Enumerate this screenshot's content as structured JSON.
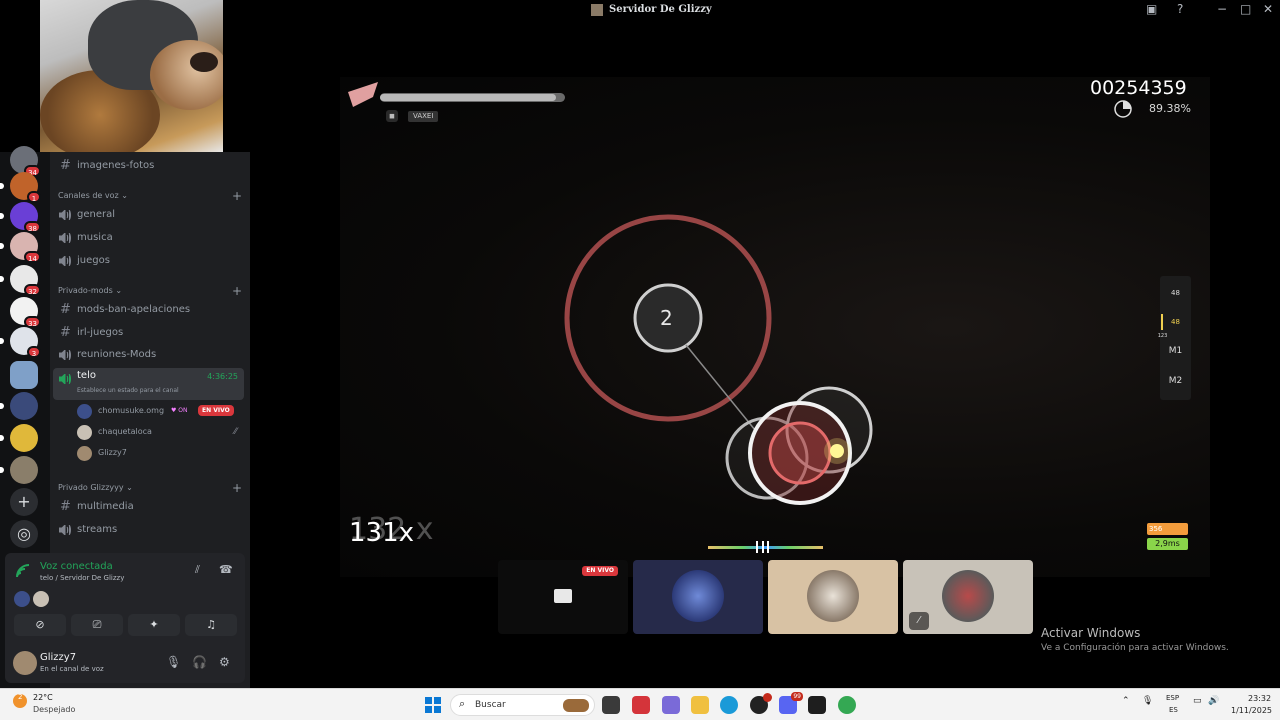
{
  "window": {
    "title": "Servidor De Glizzy"
  },
  "server_rail": {
    "badges": [
      "34",
      "1",
      "38",
      "14",
      "32",
      "33",
      "3"
    ]
  },
  "sidebar": {
    "channels_top": [
      {
        "label": "imagenes-fotos",
        "type": "text"
      }
    ],
    "categories": [
      {
        "label": "Canales de voz",
        "channels": [
          {
            "label": "general",
            "type": "voice"
          },
          {
            "label": "musica",
            "type": "voice"
          },
          {
            "label": "juegos",
            "type": "voice"
          }
        ]
      },
      {
        "label": "Privado-mods",
        "channels": [
          {
            "label": "mods-ban-apelaciones",
            "type": "text"
          },
          {
            "label": "irl-juegos",
            "type": "text"
          },
          {
            "label": "reuniones-Mods",
            "type": "voice"
          }
        ]
      },
      {
        "label": "Privado Glizzyyy",
        "channels": [
          {
            "label": "multimedia",
            "type": "text"
          },
          {
            "label": "streams",
            "type": "voice"
          }
        ]
      }
    ],
    "active_voice": {
      "label": "telo",
      "timer": "4:36:25",
      "status_prompt": "Establece un estado para el canal"
    },
    "voice_users": [
      {
        "name": "chomusuke.omg",
        "badge": "EN VIVO",
        "extra": "ON"
      },
      {
        "name": "chaquetaloca"
      },
      {
        "name": "Glizzy7"
      }
    ]
  },
  "voice_panel": {
    "title": "Voz conectada",
    "subtitle": "telo / Servidor De Glizzy",
    "user": {
      "name": "Glizzy7",
      "status": "En el canal de voz"
    }
  },
  "game": {
    "score": "00254359",
    "accuracy": "89.38%",
    "player": "VAXEI",
    "combo": "131x",
    "combo_ghost": "132 x",
    "hit_number": "2",
    "keys": [
      "48",
      "48",
      "M1",
      "M2"
    ],
    "key_counter_small": "123",
    "pp": "356",
    "ur": "2,9ms",
    "health": 0.95
  },
  "streams": {
    "live_label": "EN VIVO"
  },
  "activation": {
    "line1": "Activar Windows",
    "line2": "Ve a Configuración para activar Windows."
  },
  "taskbar": {
    "temperature": "22°C",
    "condition": "Despejado",
    "search_placeholder": "Buscar",
    "lang1": "ESP",
    "lang2": "ES",
    "time": "23:32",
    "date": "1/11/2025",
    "weather_badge": "2",
    "discord_badge": "99"
  }
}
